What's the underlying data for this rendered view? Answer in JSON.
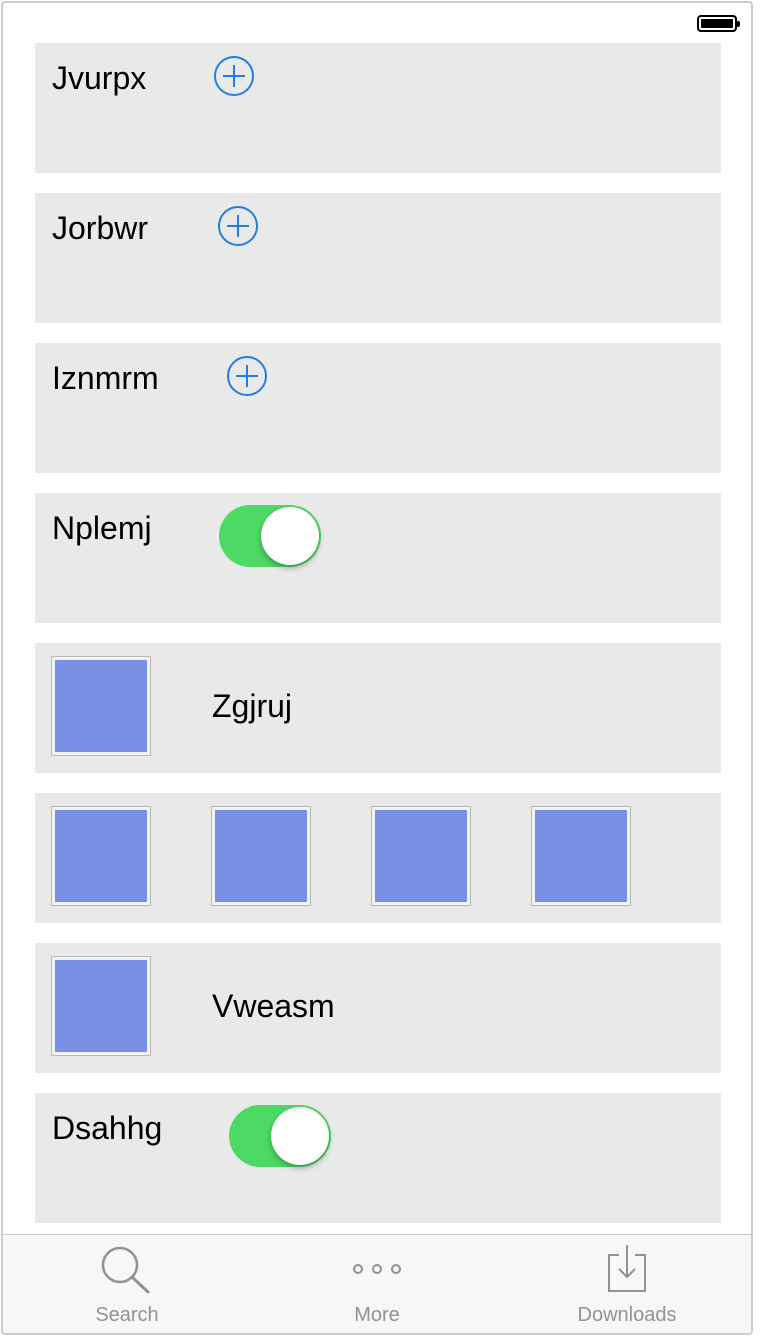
{
  "status_bar": {
    "battery_icon": "battery-full-icon"
  },
  "rows": [
    {
      "label": "Jvurpx",
      "control": "add-button"
    },
    {
      "label": "Jorbwr",
      "control": "add-button"
    },
    {
      "label": "Iznmrm",
      "control": "add-button"
    },
    {
      "label": "Nplemj",
      "control": "toggle",
      "on": true
    },
    {
      "label": "Zgjruj",
      "control": "thumbnail"
    },
    {
      "images": 4,
      "control": "thumbnail-strip"
    },
    {
      "label": "Vweasm",
      "control": "thumbnail"
    },
    {
      "label": "Dsahhg",
      "control": "toggle",
      "on": true
    }
  ],
  "colors": {
    "accent": "#1f7fe6",
    "toggle_on": "#4cd964",
    "row_background": "#e9e9e9",
    "thumbnail": "#7790e5",
    "tab_text": "#929292"
  },
  "tabbar": {
    "tabs": [
      {
        "label": "Search",
        "icon": "search-icon"
      },
      {
        "label": "More",
        "icon": "more-icon"
      },
      {
        "label": "Downloads",
        "icon": "downloads-icon"
      }
    ]
  }
}
